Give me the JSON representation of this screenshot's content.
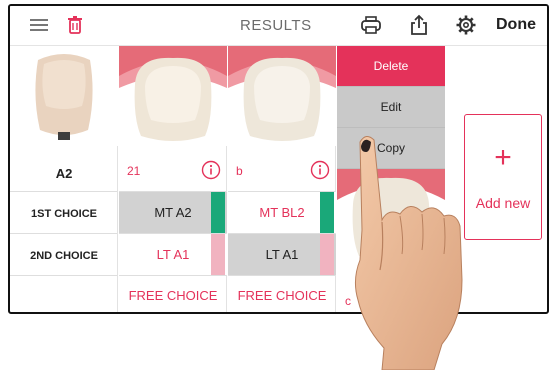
{
  "toolbar": {
    "title": "RESULTS",
    "done_label": "Done",
    "icons": [
      "menu-icon",
      "trash-icon",
      "printer-icon",
      "share-icon",
      "gear-icon"
    ]
  },
  "reference": {
    "shade": "A2",
    "first_choice_label": "1ST CHOICE",
    "second_choice_label": "2ND CHOICE"
  },
  "picks": [
    {
      "label": "21",
      "first": "MT A2",
      "second": "LT A1",
      "free": "FREE CHOICE",
      "first_selected": true,
      "second_selected": false
    },
    {
      "label": "b",
      "first": "MT BL2",
      "second": "LT A1",
      "free": "FREE CHOICE",
      "first_selected": false,
      "second_selected": true
    }
  ],
  "action_menu": {
    "delete_label": "Delete",
    "edit_label": "Edit",
    "copy_label": "Copy",
    "partial_label": "c"
  },
  "add_new": {
    "plus": "+",
    "label": "Add new"
  },
  "colors": {
    "accent": "#e4325a",
    "selected_grey": "#d2d2d2",
    "green_tab": "#1aa879",
    "pink_tab": "#f1b3c0"
  }
}
